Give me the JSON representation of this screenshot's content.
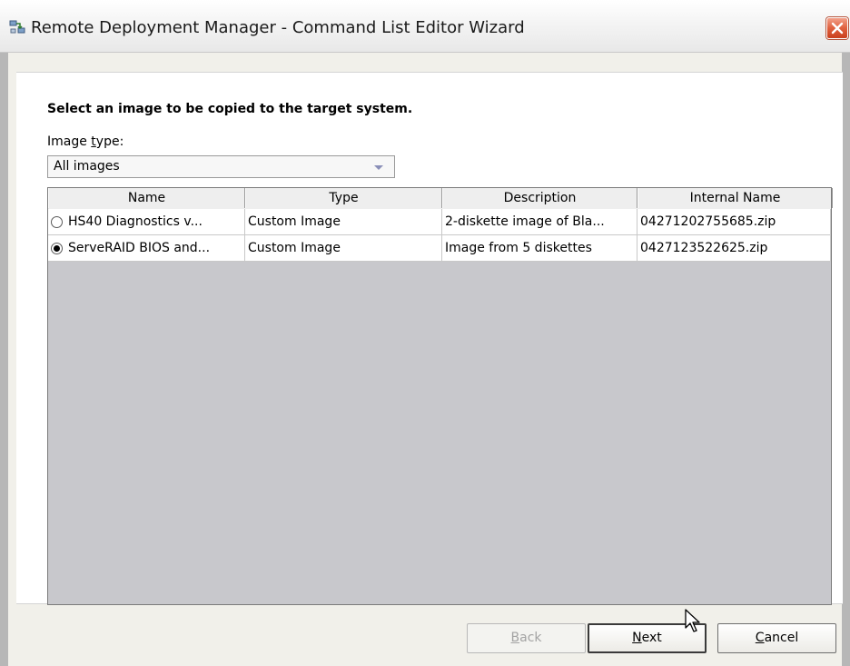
{
  "window": {
    "title": "Remote Deployment Manager - Command List Editor Wizard",
    "accent_color": "#e0603e"
  },
  "wizard": {
    "instruction": "Select an image to be copied to the target system.",
    "image_type_label_prefix": "Image ",
    "image_type_label_mnemonic": "t",
    "image_type_label_suffix": "ype:",
    "image_type_value": "All images"
  },
  "table": {
    "columns": [
      "Name",
      "Type",
      "Description",
      "Internal Name"
    ],
    "rows": [
      {
        "selected": false,
        "name": "HS40 Diagnostics v...",
        "type": "Custom Image",
        "description": "2-diskette image of Bla...",
        "internal_name": "04271202755685.zip"
      },
      {
        "selected": true,
        "name": "ServeRAID BIOS and...",
        "type": "Custom Image",
        "description": "Image from 5 diskettes",
        "internal_name": "0427123522625.zip"
      }
    ]
  },
  "buttons": {
    "back": {
      "mnemonic": "B",
      "rest": "ack",
      "enabled": false
    },
    "next": {
      "mnemonic": "N",
      "rest": "ext",
      "enabled": true
    },
    "cancel": {
      "mnemonic": "C",
      "rest": "ancel",
      "enabled": true
    }
  },
  "icons": {
    "app": "network-computers-icon",
    "close": "close-icon",
    "dropdown": "chevron-down-icon",
    "cursor": "mouse-pointer-icon"
  }
}
